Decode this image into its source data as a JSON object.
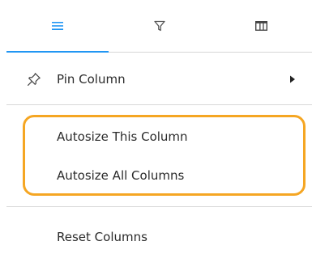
{
  "tabs": [
    {
      "icon": "menu-lines-icon",
      "active": true
    },
    {
      "icon": "filter-icon",
      "active": false
    },
    {
      "icon": "columns-icon",
      "active": false
    }
  ],
  "menu": {
    "pin_column": {
      "label": "Pin Column",
      "icon": "pin-icon",
      "has_submenu": true
    },
    "autosize_this": {
      "label": "Autosize This Column"
    },
    "autosize_all": {
      "label": "Autosize All Columns"
    },
    "reset_columns": {
      "label": "Reset Columns"
    }
  },
  "colors": {
    "accent": "#2196f3",
    "highlight": "#f5a623",
    "divider": "#d7d7d7"
  }
}
